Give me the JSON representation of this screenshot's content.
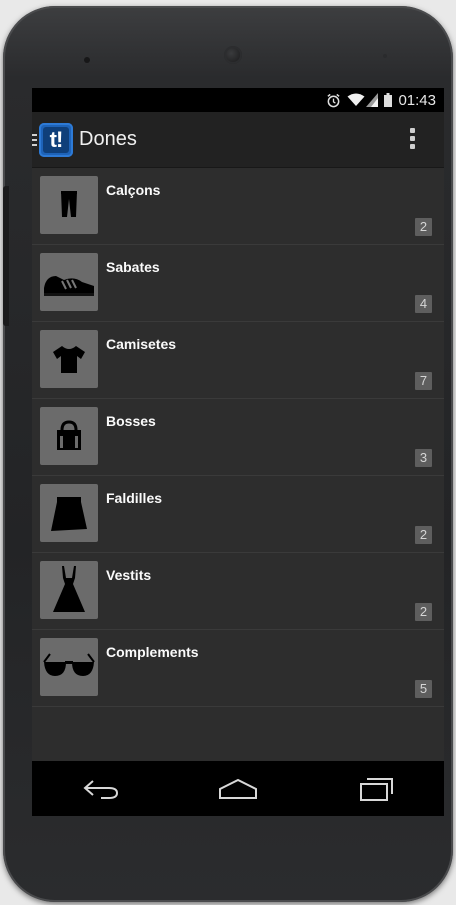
{
  "status": {
    "time": "01:43"
  },
  "app": {
    "title": "Dones",
    "logo_text": "t!"
  },
  "categories": [
    {
      "label": "Calçons",
      "count": "2",
      "icon": "trousers-icon"
    },
    {
      "label": "Sabates",
      "count": "4",
      "icon": "sneaker-icon"
    },
    {
      "label": "Camisetes",
      "count": "7",
      "icon": "tshirt-icon"
    },
    {
      "label": "Bosses",
      "count": "3",
      "icon": "handbag-icon"
    },
    {
      "label": "Faldilles",
      "count": "2",
      "icon": "skirt-icon"
    },
    {
      "label": "Vestits",
      "count": "2",
      "icon": "dress-icon"
    },
    {
      "label": "Complements",
      "count": "5",
      "icon": "sunglasses-icon"
    }
  ],
  "colors": {
    "logo": "#1e63b8",
    "background": "#2d2d2d",
    "thumb": "#6b6b6b"
  }
}
